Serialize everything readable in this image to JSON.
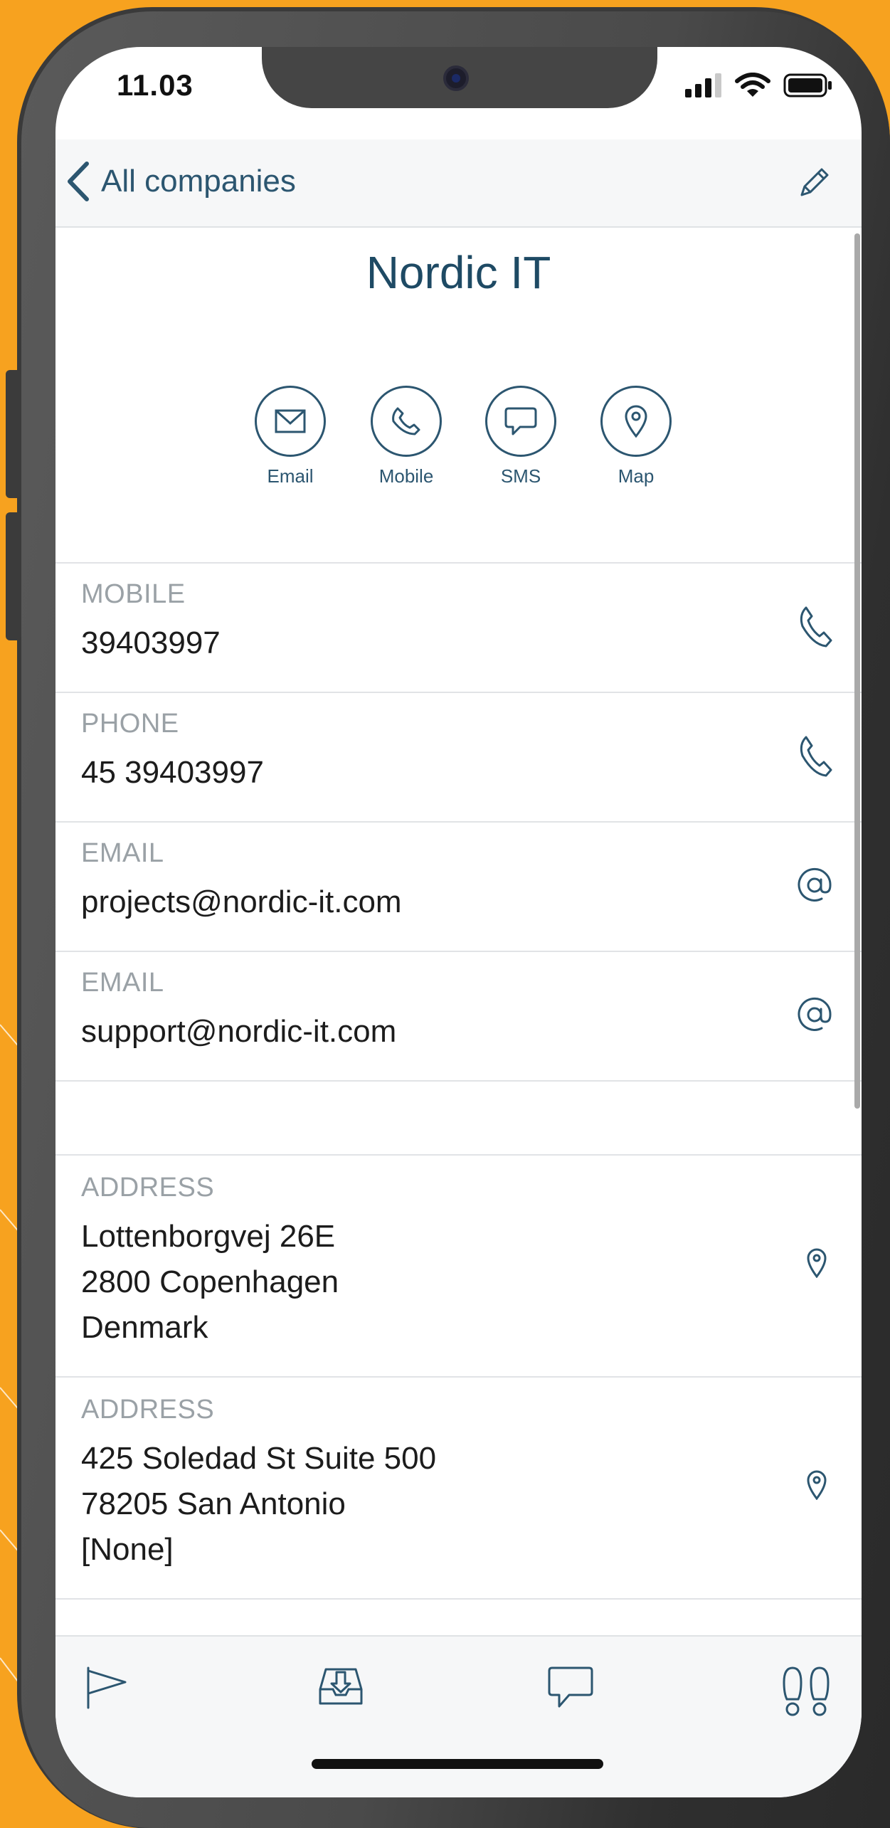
{
  "status_bar": {
    "time": "11.03"
  },
  "nav": {
    "back_label": "All companies"
  },
  "company": {
    "name": "Nordic IT"
  },
  "actions": [
    {
      "label": "Email"
    },
    {
      "label": "Mobile"
    },
    {
      "label": "SMS"
    },
    {
      "label": "Map"
    }
  ],
  "fields": {
    "mobile": {
      "label": "MOBILE",
      "value": "39403997"
    },
    "phone": {
      "label": "PHONE",
      "value": "45 39403997"
    },
    "email1": {
      "label": "EMAIL",
      "value": "projects@nordic-it.com"
    },
    "email2": {
      "label": "EMAIL",
      "value": "support@nordic-it.com"
    },
    "address1": {
      "label": "ADDRESS",
      "line1": "Lottenborgvej 26E",
      "line2": "2800 Copenhagen",
      "line3": "Denmark"
    },
    "address2": {
      "label": "ADDRESS",
      "line1": "425 Soledad St Suite 500",
      "line2": "78205 San Antonio",
      "line3": "[None]"
    }
  },
  "icons": {
    "back": "chevron-left-icon",
    "edit": "pencil-icon",
    "email": "envelope-icon",
    "mobile": "phone-icon",
    "sms": "speech-bubble-icon",
    "map": "map-pin-icon",
    "email_field": "at-sign-icon",
    "tabs": [
      "flag-icon",
      "inbox-icon",
      "chat-icon",
      "footprints-icon"
    ]
  },
  "colors": {
    "background": "#f7a21f",
    "accent": "#2c5670",
    "label_gray": "#9aa1a6"
  }
}
